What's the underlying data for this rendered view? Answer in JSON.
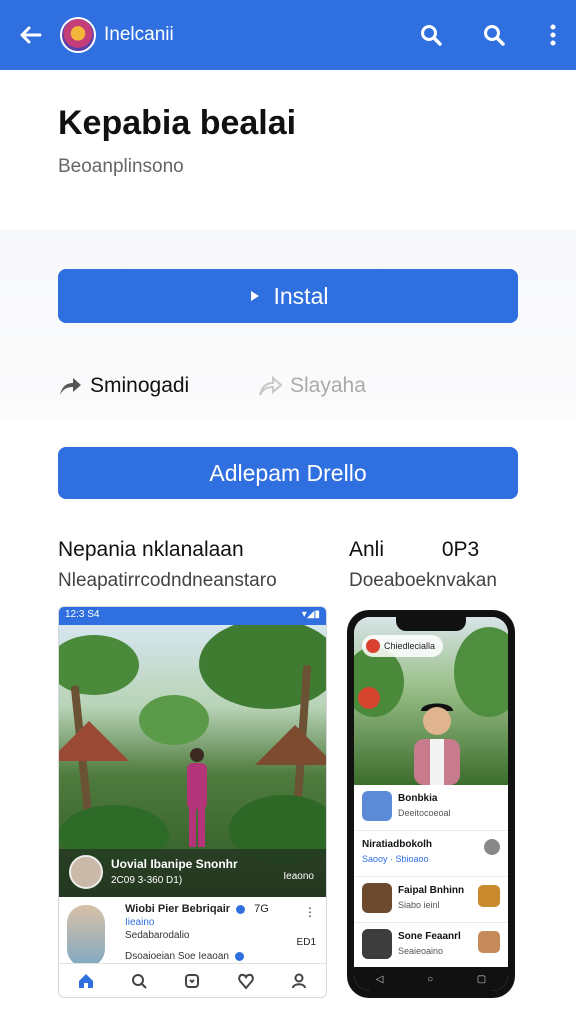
{
  "appbar": {
    "title": "Inelcanii",
    "back_icon": "arrow-left-icon",
    "icons": [
      "search-icon",
      "search-icon",
      "more-vert-icon"
    ]
  },
  "hero": {
    "title": "Kepabia bealai",
    "subtitle": "Beoanplinsono"
  },
  "install": {
    "label": "Instal",
    "icon": "play-icon"
  },
  "actions": {
    "share_label": "Sminogadi",
    "forward_label": "Slayaha"
  },
  "secondary_button": {
    "label": "Adlepam Drello"
  },
  "info_left": {
    "line1": "Nepania nklanalaan",
    "line2": "Nleapatirrcodndneanstaro"
  },
  "info_right": {
    "line1_a": "Anli",
    "line1_b": "0P3",
    "line2": "Doeaboeknvakan"
  },
  "screenshot1": {
    "status_left": "12:3 S4",
    "status_right": "▾◢▮",
    "caption_title": "Uovial Ibanipe Snonhr",
    "caption_sub": "2C09 3-360 D1)",
    "caption_right": "Ieaono",
    "post_name": "Wiobi Pier Bebriqair",
    "post_badge": "7G",
    "post_tag": "Iieaino",
    "post_tag2": "Sedabarodalio",
    "post_meta": "Dsoaioeian Soe Ieaoan",
    "post_right": "ED1"
  },
  "screenshot2": {
    "pill_label": "Chiedlecialla",
    "items": [
      {
        "title": "Bonbkia",
        "sub": "Deeitocoeoal",
        "color": "#5b8ad6"
      },
      {
        "title": "Niratiadbokolh",
        "sub": "Saooy · Sbioaoo",
        "color": "#888888"
      },
      {
        "title": "Faipal Bnhinn",
        "sub": "Siabo ieinl",
        "color": "#6d4a2e"
      },
      {
        "title": "Sone Feaanrl",
        "sub": "Seaieoaino",
        "color": "#3d3d3d"
      }
    ]
  },
  "colors": {
    "primary": "#2f6fe0",
    "text": "#111111",
    "muted": "#666666"
  }
}
